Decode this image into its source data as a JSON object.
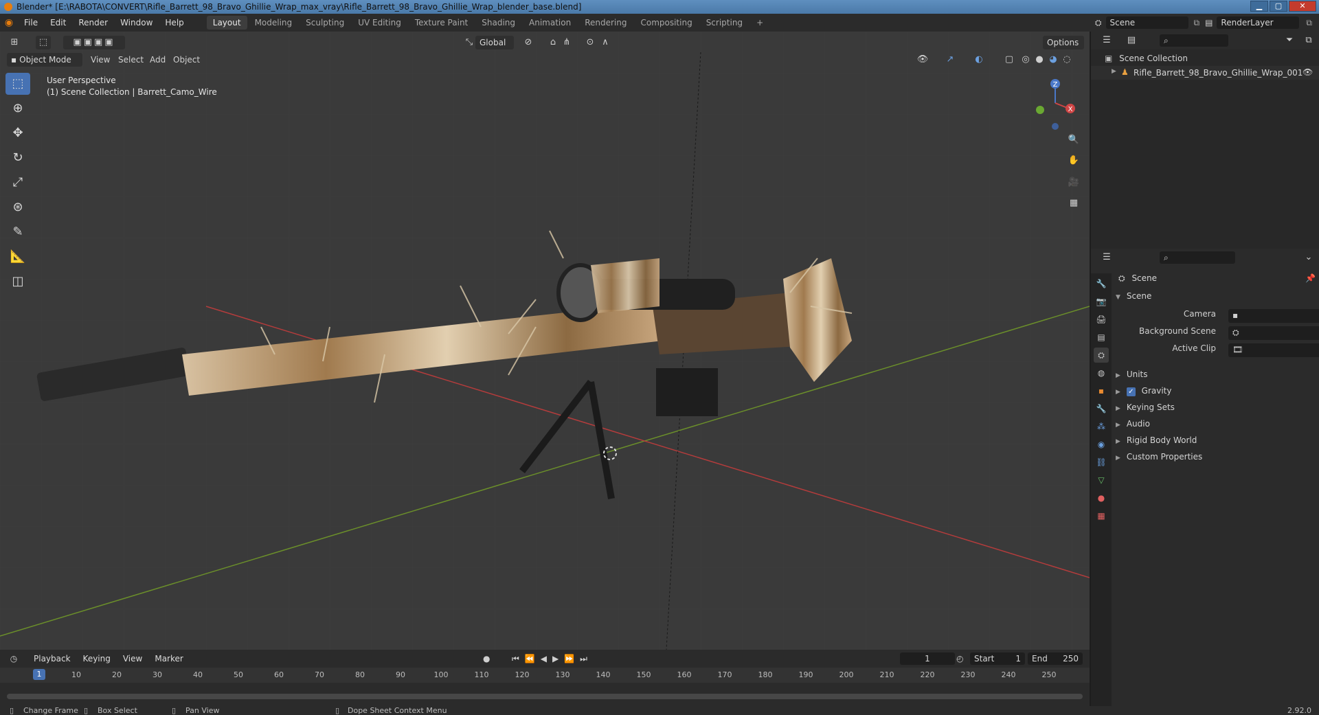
{
  "window": {
    "title": "Blender* [E:\\RABOTA\\CONVERT\\Rifle_Barrett_98_Bravo_Ghillie_Wrap_max_vray\\Rifle_Barrett_98_Bravo_Ghillie_Wrap_blender_base.blend]",
    "minimize": "▁",
    "maximize": "▢",
    "close": "✕"
  },
  "menu": [
    "File",
    "Edit",
    "Render",
    "Window",
    "Help"
  ],
  "workspaces": [
    "Layout",
    "Modeling",
    "Sculpting",
    "UV Editing",
    "Texture Paint",
    "Shading",
    "Animation",
    "Rendering",
    "Compositing",
    "Scripting"
  ],
  "active_workspace": "Layout",
  "add_workspace": "+",
  "scene_field": "Scene",
  "renderlayer_field": "RenderLayer",
  "viewport": {
    "mode": "Object Mode",
    "menus": [
      "View",
      "Select",
      "Add",
      "Object"
    ],
    "transform_orientation": "Global",
    "options": "Options",
    "perspective_label": "User Perspective",
    "collection_label": "(1) Scene Collection | Barrett_Camo_Wire",
    "gizmo_axes": {
      "x": "X",
      "y": "Y",
      "z": "Z"
    }
  },
  "timeline": {
    "menus": [
      "Playback",
      "Keying",
      "View",
      "Marker"
    ],
    "current_frame": "1",
    "start_label": "Start",
    "start_value": "1",
    "end_label": "End",
    "end_value": "250",
    "ticks": [
      "1",
      "10",
      "20",
      "30",
      "40",
      "50",
      "60",
      "70",
      "80",
      "90",
      "100",
      "110",
      "120",
      "130",
      "140",
      "150",
      "160",
      "170",
      "180",
      "190",
      "200",
      "210",
      "220",
      "230",
      "240",
      "250"
    ]
  },
  "statusbar": {
    "items": [
      "Change Frame",
      "Box Select",
      "Pan View",
      "Dope Sheet Context Menu"
    ],
    "version": "2.92.0"
  },
  "outliner": {
    "root": "Scene Collection",
    "items": [
      "Rifle_Barrett_98_Bravo_Ghillie_Wrap_001"
    ]
  },
  "properties": {
    "header": "Scene",
    "panel": "Scene",
    "camera_label": "Camera",
    "background_label": "Background Scene",
    "clip_label": "Active Clip",
    "subpanels": [
      "Units",
      "Gravity",
      "Keying Sets",
      "Audio",
      "Rigid Body World",
      "Custom Properties"
    ],
    "gravity_checked": true
  }
}
